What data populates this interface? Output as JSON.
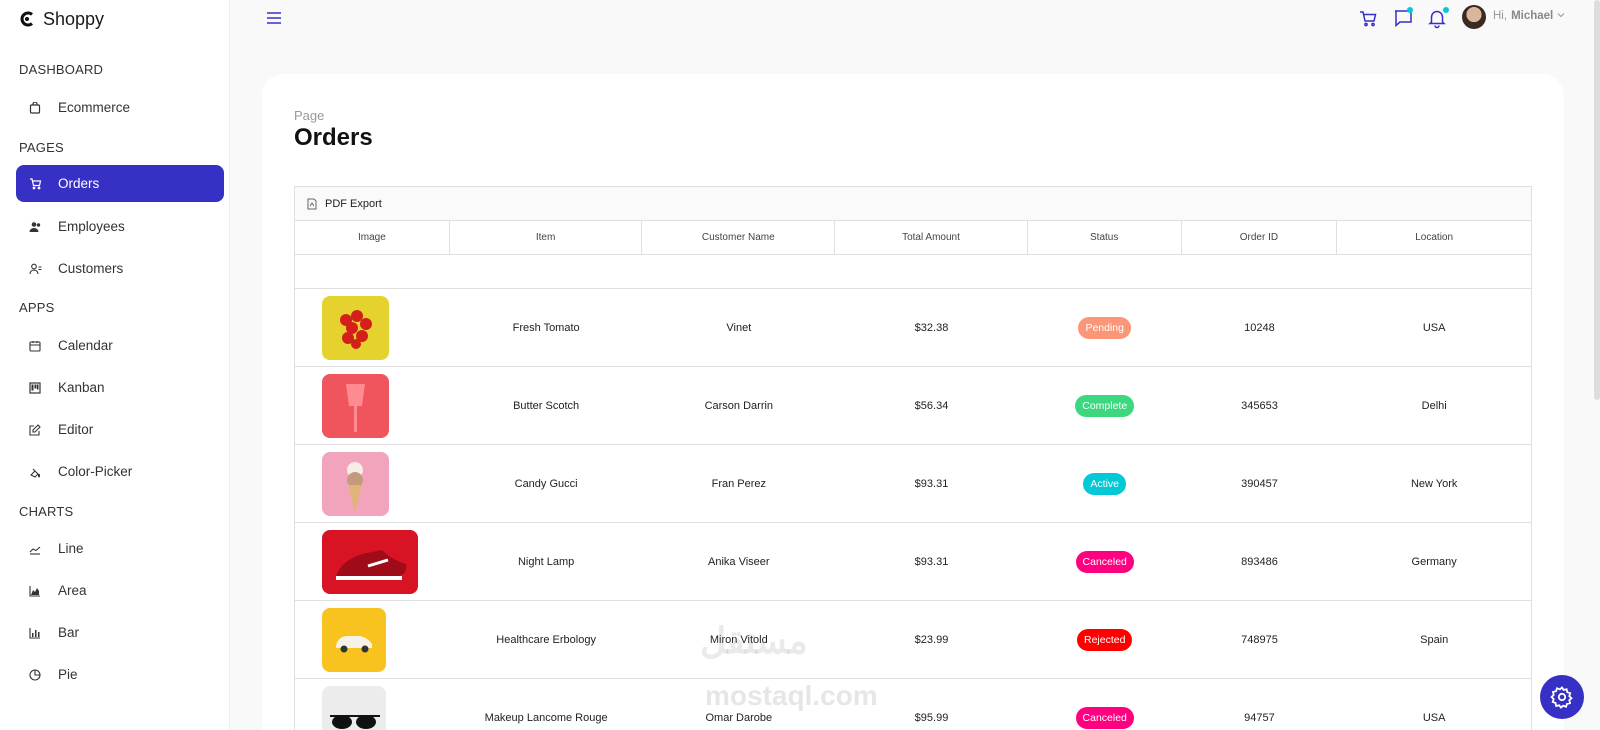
{
  "app": {
    "brand": "Shoppy"
  },
  "sidebar": {
    "sections": [
      {
        "title": "DASHBOARD"
      },
      {
        "title": "PAGES"
      },
      {
        "title": "APPS"
      },
      {
        "title": "CHARTS"
      }
    ],
    "items": [
      {
        "label": "Ecommerce",
        "icon": "shopping-bag-icon"
      },
      {
        "label": "Orders",
        "icon": "cart-icon",
        "active": true
      },
      {
        "label": "Employees",
        "icon": "employees-icon"
      },
      {
        "label": "Customers",
        "icon": "customers-icon"
      },
      {
        "label": "Calendar",
        "icon": "calendar-icon"
      },
      {
        "label": "Kanban",
        "icon": "kanban-icon"
      },
      {
        "label": "Editor",
        "icon": "edit-icon"
      },
      {
        "label": "Color-Picker",
        "icon": "color-picker-icon"
      },
      {
        "label": "Line",
        "icon": "line-chart-icon"
      },
      {
        "label": "Area",
        "icon": "area-chart-icon"
      },
      {
        "label": "Bar",
        "icon": "bar-chart-icon"
      },
      {
        "label": "Pie",
        "icon": "pie-chart-icon"
      }
    ],
    "accent": "#3730c4"
  },
  "header": {
    "greeting": "Hi,",
    "user": "Michael",
    "notification_dot_color": "#03c9d7"
  },
  "page": {
    "breadcrumb": "Page",
    "title": "Orders"
  },
  "grid": {
    "export_label": "PDF Export",
    "columns": [
      "Image",
      "Item",
      "Customer Name",
      "Total Amount",
      "Status",
      "Order ID",
      "Location"
    ],
    "rows": [
      {
        "item": "Fresh Tomato",
        "customer": "Vinet",
        "amount": "$32.38",
        "status": "Pending",
        "status_color": "#fb9678",
        "order_id": "10248",
        "location": "USA",
        "image": "tomatoes on yellow background"
      },
      {
        "item": "Butter Scotch",
        "customer": "Carson Darrin",
        "amount": "$56.34",
        "status": "Complete",
        "status_color": "#3cd77f",
        "order_id": "345653",
        "location": "Delhi",
        "image": "red cup on pink background"
      },
      {
        "item": "Candy Gucci",
        "customer": "Fran Perez",
        "amount": "$93.31",
        "status": "Active",
        "status_color": "#03c9d7",
        "order_id": "390457",
        "location": "New York",
        "image": "ice cream cone on pink background"
      },
      {
        "item": "Night Lamp",
        "customer": "Anika Viseer",
        "amount": "$93.31",
        "status": "Canceled",
        "status_color": "#ff0080",
        "order_id": "893486",
        "location": "Germany",
        "image": "red sneaker on red background"
      },
      {
        "item": "Healthcare Erbology",
        "customer": "Miron Vitold",
        "amount": "$23.99",
        "status": "Rejected",
        "status_color": "#ff0000",
        "order_id": "748975",
        "location": "Spain",
        "image": "toy car on yellow background"
      },
      {
        "item": "Makeup Lancome Rouge",
        "customer": "Omar Darobe",
        "amount": "$95.99",
        "status": "Canceled",
        "status_color": "#ff0080",
        "order_id": "94757",
        "location": "USA",
        "image": "sunglasses on white background"
      }
    ]
  },
  "watermark": {
    "line1": "مستقل",
    "line2": "mostaql.com"
  }
}
